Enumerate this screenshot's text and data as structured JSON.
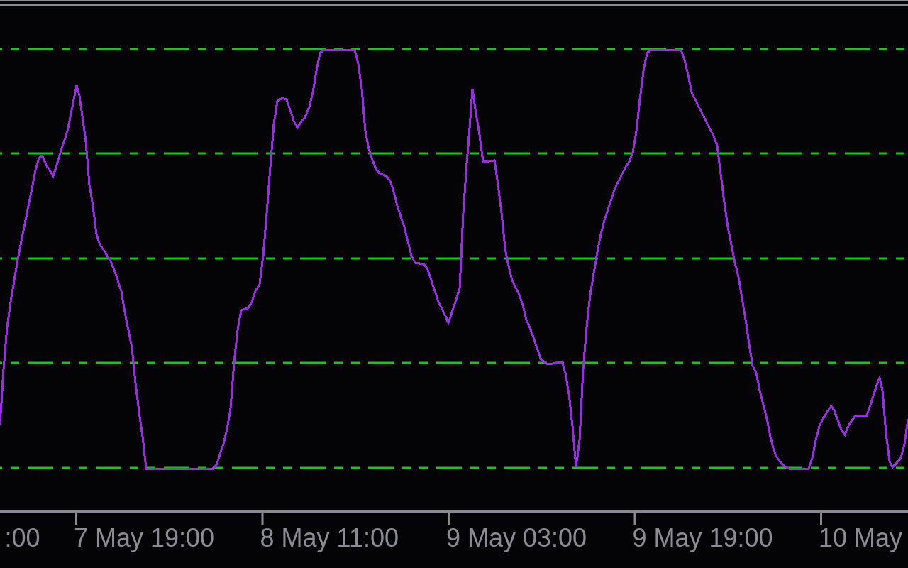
{
  "chart": {
    "time_axis": {
      "labels": [
        ":00",
        "7 May 19:00",
        "8 May 11:00",
        "9 May 03:00",
        "9 May 19:00",
        "10 May"
      ]
    }
  }
}
